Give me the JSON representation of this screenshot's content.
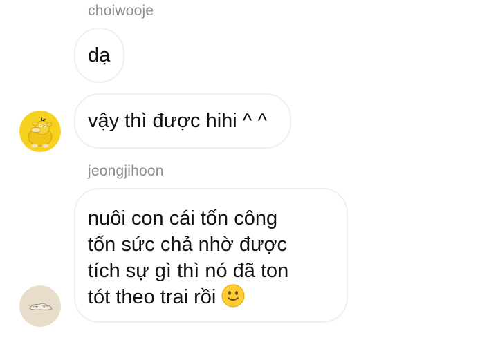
{
  "messages": [
    {
      "sender": "choiwooje",
      "bubbles": [
        "dạ",
        "vậy thì được hihi ^ ^"
      ]
    },
    {
      "sender": "jeongjihoon",
      "lines": [
        "nuôi con cái tốn công",
        "tốn sức chả nhờ được",
        "tích sự gì thì nó đã ton",
        "tót theo trai rồi"
      ],
      "emoji": "slightly-smiling-face-icon"
    }
  ],
  "avatars": [
    {
      "icon": "psyduck-avatar-icon",
      "color": "#f6d21e"
    },
    {
      "icon": "sketch-avatar-icon",
      "color": "#e8dccb"
    }
  ]
}
